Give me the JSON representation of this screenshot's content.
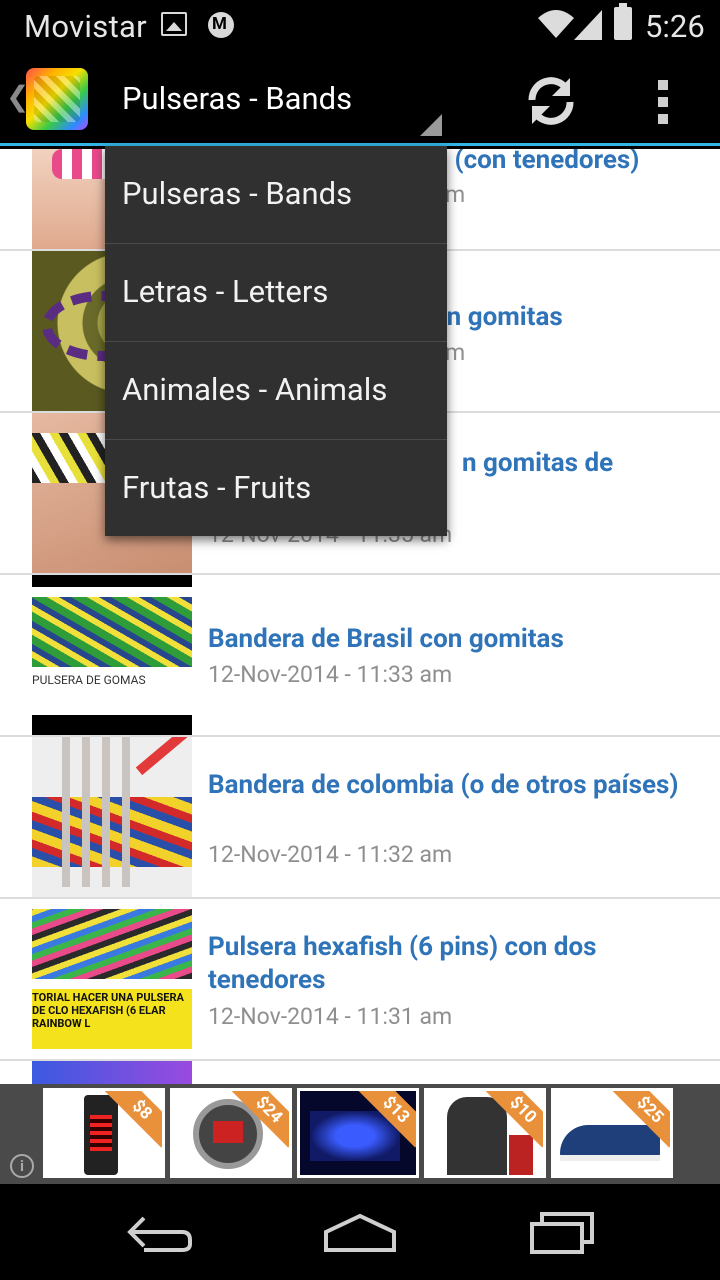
{
  "status_bar": {
    "carrier": "Movistar",
    "time": "5:26",
    "icons": [
      "gallery-icon",
      "motorola-icon",
      "wifi-icon",
      "signal-icon",
      "battery-icon"
    ]
  },
  "action_bar": {
    "selected_category": "Pulseras - Bands",
    "accent_color": "#33b5e5",
    "actions": [
      "refresh-icon",
      "overflow-menu-icon"
    ]
  },
  "dropdown": {
    "items": [
      {
        "label": "Pulseras - Bands"
      },
      {
        "label": "Letras - Letters"
      },
      {
        "label": "Animales - Animals"
      },
      {
        "label": "Frutas - Fruits"
      }
    ]
  },
  "list": {
    "items": [
      {
        "title": "os (con tenedores)",
        "date": "m"
      },
      {
        "title": "on gomitas",
        "date": "m"
      },
      {
        "title": "n gomitas de",
        "date": "12-Nov-2014 - 11:35 am"
      },
      {
        "title": "Bandera de Brasil con gomitas",
        "date": "12-Nov-2014 - 11:33 am"
      },
      {
        "title": "Bandera de colombia (o de otros países)",
        "date": "12-Nov-2014 - 11:32 am"
      },
      {
        "title": "Pulsera hexafish (6 pins) con dos tenedores",
        "date": "12-Nov-2014 - 11:31 am"
      }
    ],
    "thumb_texts": {
      "brasil": "PULSERA DE GOMAS",
      "hexafish": "TORIAL HACER UNA PULSERA DE CLO HEXAFISH (6 ELAR RAINBOW L"
    },
    "title_color": "#2f73b8"
  },
  "ad_banner": {
    "prices": [
      "$8",
      "$24",
      "$13",
      "$10",
      "$25"
    ]
  }
}
